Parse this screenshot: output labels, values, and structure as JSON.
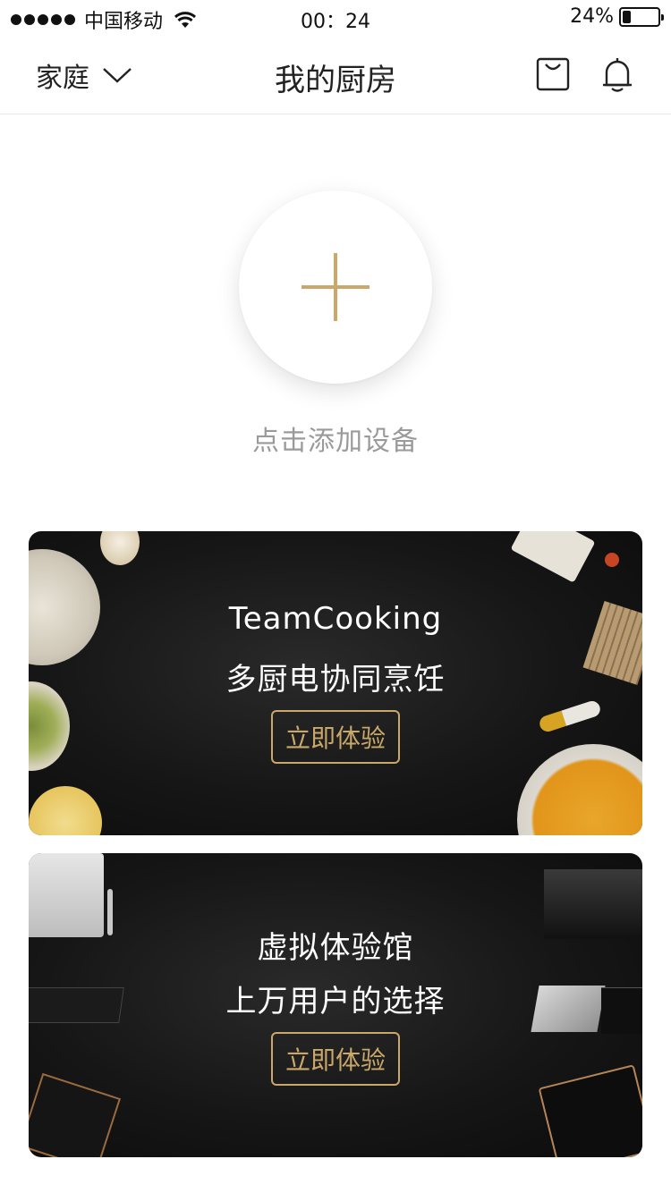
{
  "status_bar": {
    "carrier": "中国移动",
    "time": "00：24",
    "battery_percent": "24%",
    "battery_level": 0.24
  },
  "nav": {
    "home_label": "家庭",
    "title": "我的厨房",
    "icons": [
      "chevron-down-icon",
      "shopping-bag-icon",
      "bell-icon"
    ]
  },
  "add_device": {
    "label": "点击添加设备",
    "accent": "#c9a86a"
  },
  "banners": [
    {
      "line1": "TeamCooking",
      "line2": "多厨电协同烹饪",
      "cta": "立即体验"
    },
    {
      "line1": "虚拟体验馆",
      "line2": "上万用户的选择",
      "cta": "立即体验"
    }
  ]
}
